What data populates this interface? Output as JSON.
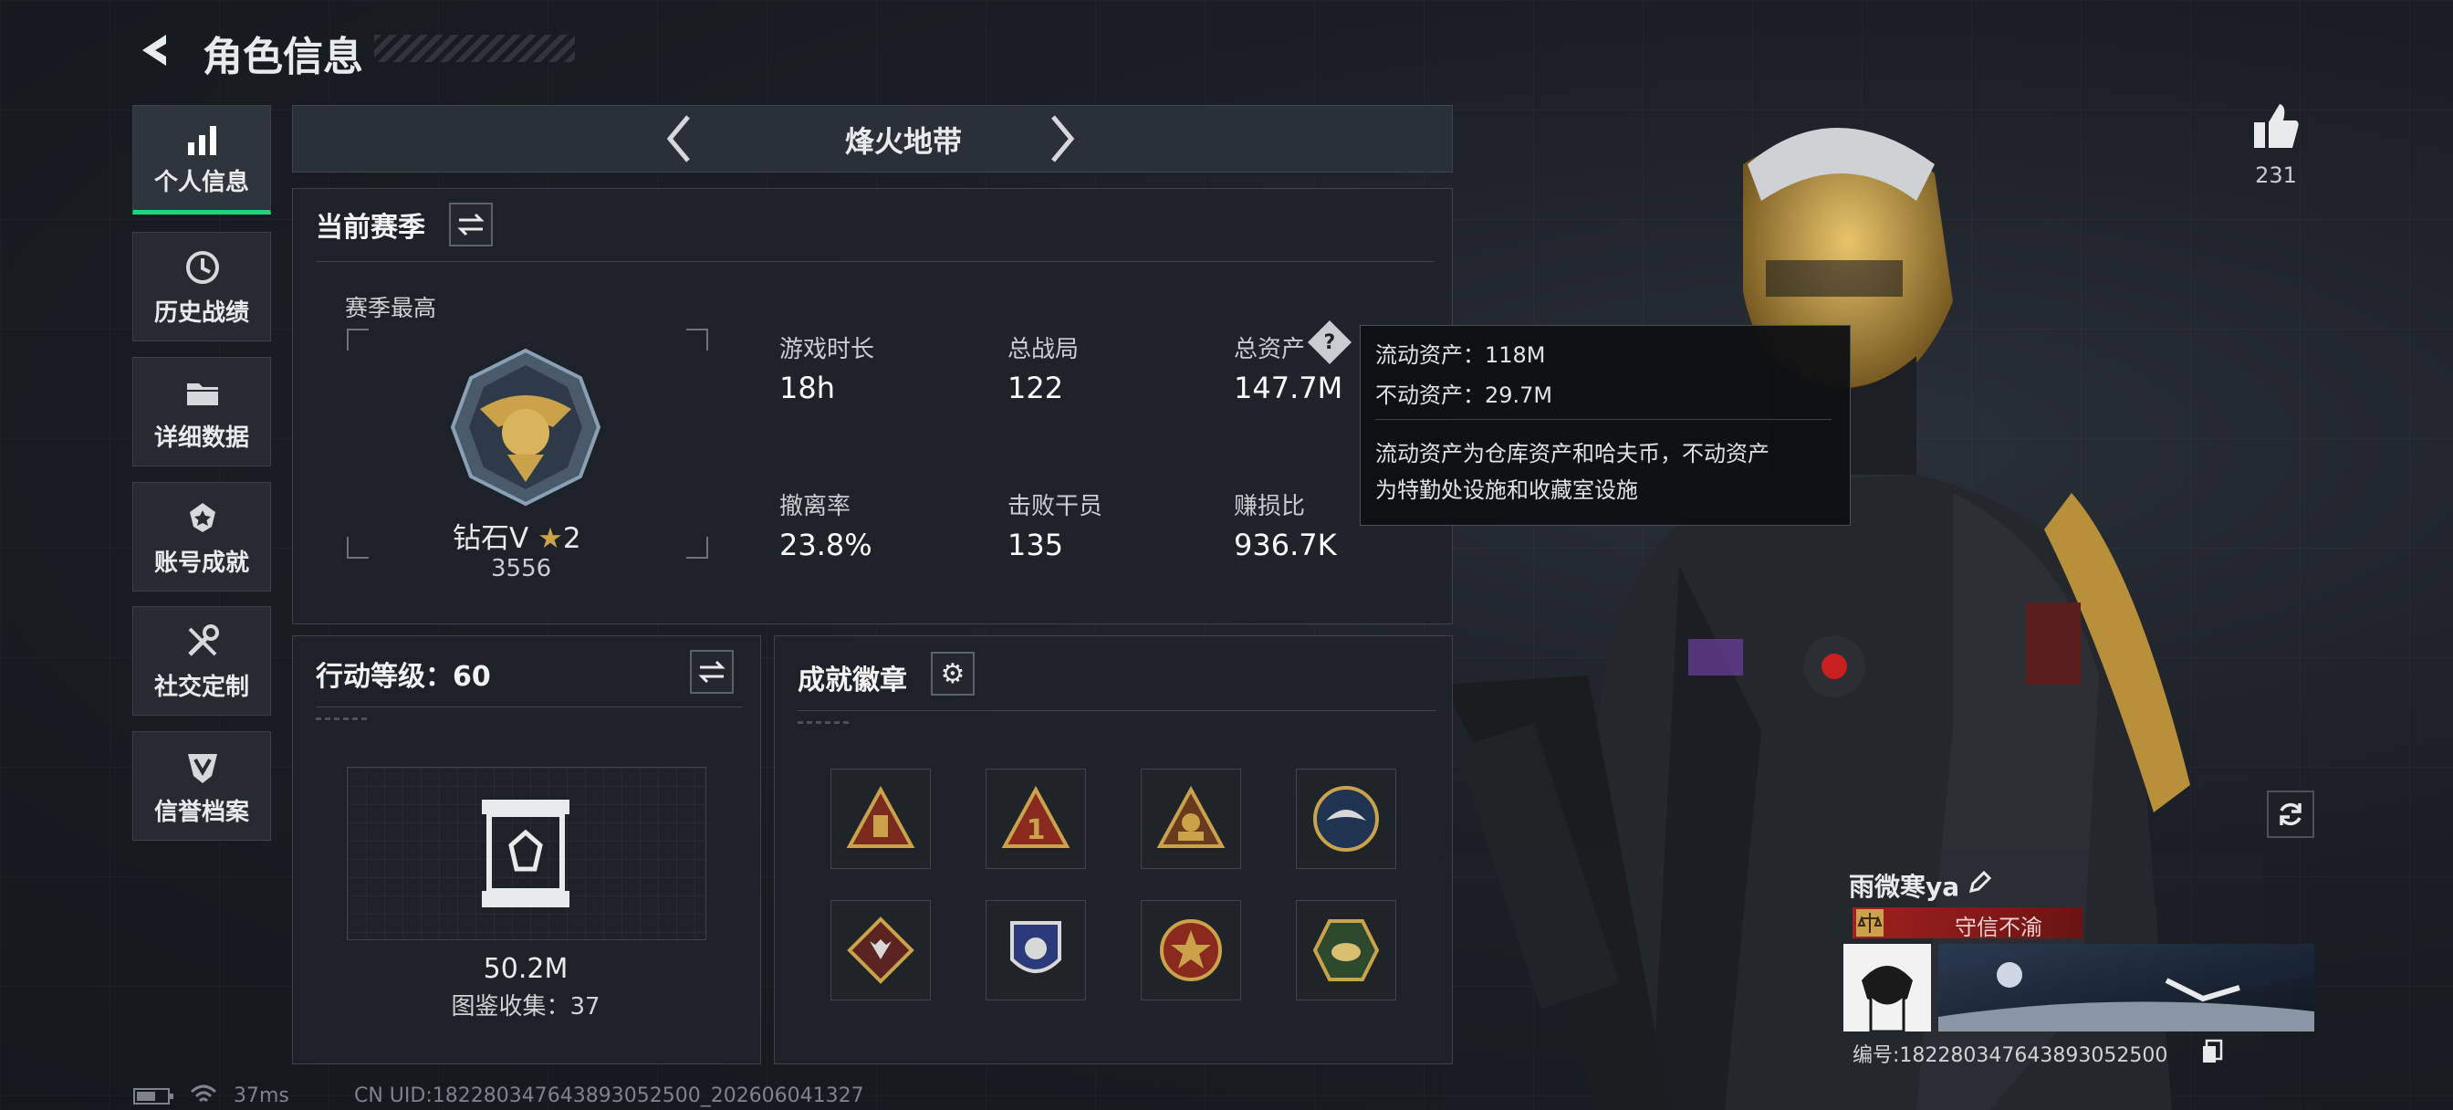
{
  "header": {
    "title": "角色信息"
  },
  "sidebar": {
    "items": [
      {
        "label": "个人信息",
        "icon": "bar-chart-icon",
        "active": true
      },
      {
        "label": "历史战绩",
        "icon": "history-clock-icon"
      },
      {
        "label": "详细数据",
        "icon": "folder-icon"
      },
      {
        "label": "账号成就",
        "icon": "medal-icon"
      },
      {
        "label": "社交定制",
        "icon": "tools-icon"
      },
      {
        "label": "信誉档案",
        "icon": "shield-icon"
      }
    ]
  },
  "mode_selector": {
    "label": "烽火地带"
  },
  "season": {
    "title": "当前赛季",
    "best_label": "赛季最高",
    "rank_name": "钻石V",
    "rank_stars": "2",
    "rank_score": "3556",
    "stats": [
      {
        "label": "游戏时长",
        "value": "18h"
      },
      {
        "label": "总战局",
        "value": "122"
      },
      {
        "label": "总资产",
        "value": "147.7M"
      },
      {
        "label": "撤离率",
        "value": "23.8%"
      },
      {
        "label": "击败干员",
        "value": "135"
      },
      {
        "label": "赚损比",
        "value": "936.7K"
      }
    ]
  },
  "tooltip": {
    "line1": "流动资产：118M",
    "line2": "不动资产：29.7M",
    "line3": "流动资产为仓库资产和哈夫币，不动资产",
    "line4": "为特勤处设施和收藏室设施"
  },
  "action_level": {
    "title": "行动等级：60",
    "value": "50.2M",
    "collection": "图鉴收集：37"
  },
  "achievements": {
    "title": "成就徽章",
    "badges": [
      "badge-1",
      "badge-2",
      "badge-3",
      "badge-4",
      "badge-5",
      "badge-6",
      "badge-7",
      "badge-8"
    ]
  },
  "likes": {
    "count": "231"
  },
  "profile": {
    "name": "雨微寒ya",
    "credit_tag": "守信不渝",
    "id_text": "编号:182280347643893052500"
  },
  "status_bar": {
    "ping": "37ms",
    "uid_text": "CN UID:182280347643893052500_202606041327"
  },
  "colors": {
    "accent_green": "#21d37a",
    "tag_red": "#8c1c1c",
    "gold": "#c9a24a"
  }
}
